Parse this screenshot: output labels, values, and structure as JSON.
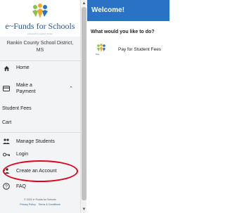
{
  "brand": {
    "logo_text": "e~Funds for Schools",
    "tagline": "powered by paypal / lovely",
    "colors": {
      "primary": "#2a72c5",
      "highlight": "#e0001b",
      "logo_blue": "#25578e"
    }
  },
  "sidebar": {
    "district": "Rankin County School District, MS",
    "items": [
      {
        "label": "Home",
        "icon": "home-icon"
      },
      {
        "label": "Make a Payment",
        "icon": "payment-card-icon",
        "expanded": true
      },
      {
        "label": "Student Fees"
      },
      {
        "label": "Cart"
      },
      {
        "label": "Manage Students",
        "icon": "people-icon"
      },
      {
        "label": "Login",
        "icon": "key-icon"
      },
      {
        "label": "Create an Account",
        "icon": "add-person-icon"
      },
      {
        "label": "FAQ",
        "icon": "help-circle-icon"
      }
    ],
    "footer": {
      "copyright": "© 2022 e~Funds for Schools",
      "privacy": "Privacy Policy",
      "terms": "Terms & Conditions"
    }
  },
  "main": {
    "header": "Welcome!",
    "question": "What would you like to do?",
    "options": [
      {
        "label": "Pay for Student Fees",
        "caption": "Fees"
      }
    ]
  }
}
